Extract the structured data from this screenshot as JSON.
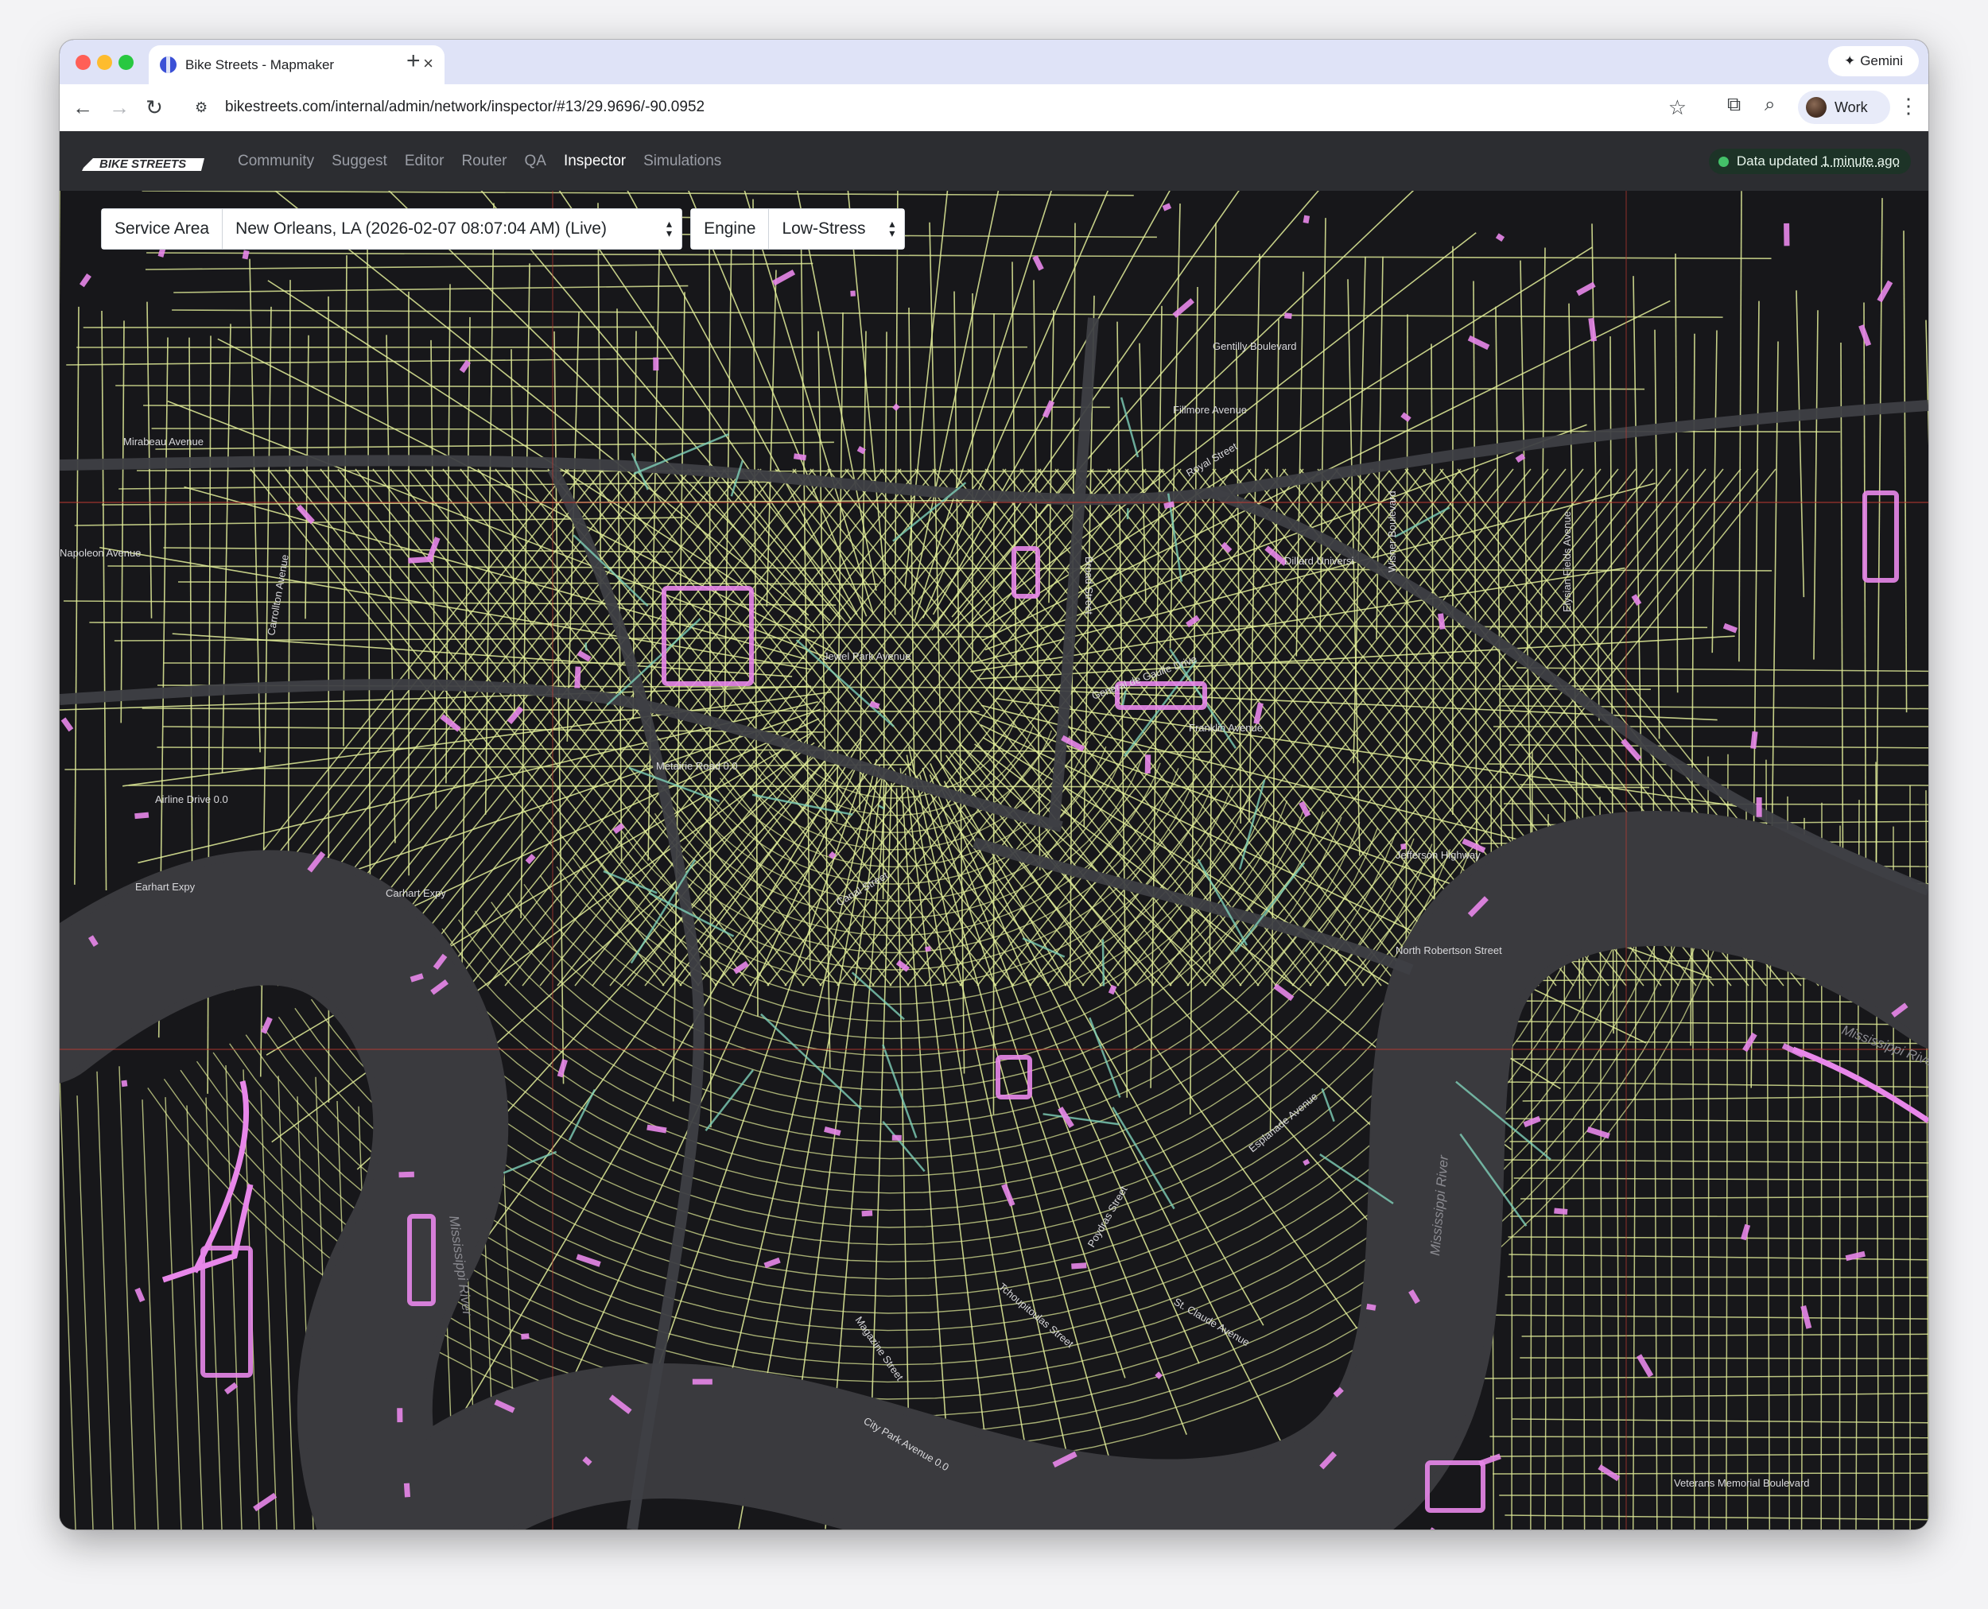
{
  "browser": {
    "tab_title": "Bike Streets - Mapmaker",
    "new_tab": "+",
    "close": "×",
    "gemini_label": "Gemini",
    "url_host": "bikestreets.com",
    "url_path": "/internal/admin/network/inspector/#13/29.9696/-90.0952",
    "profile_label": "Work"
  },
  "app": {
    "logo_text": "BIKE STREETS",
    "nav": [
      "Community",
      "Suggest",
      "Editor",
      "Router",
      "QA",
      "Inspector",
      "Simulations"
    ],
    "active_nav": "Inspector",
    "status_prefix": "Data updated",
    "status_time": "1 minute ago",
    "status_color": "#44c169"
  },
  "controls": {
    "service_area_label": "Service Area",
    "service_area_value": "New Orleans, LA (2026-02-07 08:07:04 AM) (Live)",
    "engine_label": "Engine",
    "engine_value": "Low-Stress"
  },
  "map": {
    "colors": {
      "background": "#17171a",
      "water": "#3a3a3e",
      "street": "#e4f09a",
      "protected": "#e887ea",
      "secondary": "#7fd1b9",
      "highway": "#3e3f44",
      "boundary": "#c03a32"
    },
    "labels": [
      "Mississippi River",
      "Mississippi River",
      "Mississippi River",
      "Mississippi River",
      "Carrollton Avenue",
      "Airline Drive 0.0",
      "Earhart Expy",
      "Carhart Expy",
      "Metairie Road 0.0",
      "Canal Street",
      "Esplanade Avenue",
      "St. Claude Avenue",
      "Dillard Universi",
      "Tchoupitoulas Street",
      "Magazine Street",
      "Napoleon Avenue",
      "Jefferson Highway",
      "North Robertson Street",
      "Royal Street",
      "Gentilly Boulevard",
      "Fillmore Avenue",
      "Mirabeau Avenue",
      "Veterans Memorial Boulevard",
      "General de Gaulle Drive",
      "Jewel Park Avenue",
      "City Park Avenue 0.0",
      "Poydras Street",
      "Broad Street",
      "Wisner Boulevard",
      "Elysian Fields Avenue",
      "Franklin Avenue",
      "Holiday Drive"
    ]
  }
}
